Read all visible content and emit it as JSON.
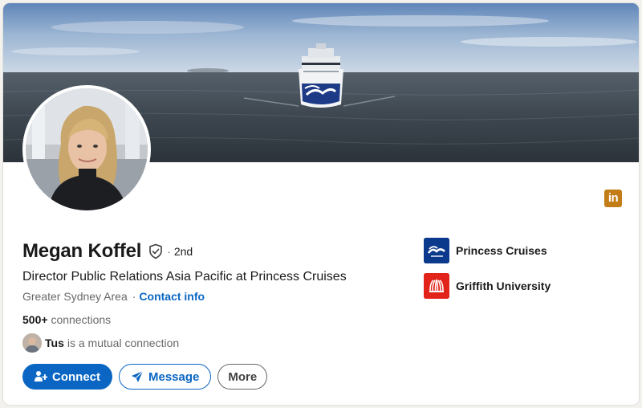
{
  "profile": {
    "name": "Megan Koffel",
    "degree_prefix": "·",
    "degree": "2nd",
    "headline": "Director Public Relations Asia Pacific at Princess Cruises",
    "location": "Greater Sydney Area",
    "location_sep": "·",
    "contact_info_label": "Contact info",
    "connections_count": "500+",
    "connections_label": "connections",
    "mutual": {
      "name": "Tus",
      "text": "is a mutual connection"
    }
  },
  "actions": {
    "connect_label": "Connect",
    "message_label": "Message",
    "more_label": "More"
  },
  "orgs": [
    {
      "name": "Princess Cruises",
      "logo_color": "#0b3a8c",
      "icon": "princess-cruises-logo"
    },
    {
      "name": "Griffith University",
      "logo_color": "#e2231a",
      "icon": "griffith-university-logo"
    }
  ],
  "badge": {
    "label": "in",
    "color": "#c37d16"
  },
  "colors": {
    "accent": "#0a66c2",
    "background": "#f3f2ef",
    "card": "#ffffff"
  }
}
